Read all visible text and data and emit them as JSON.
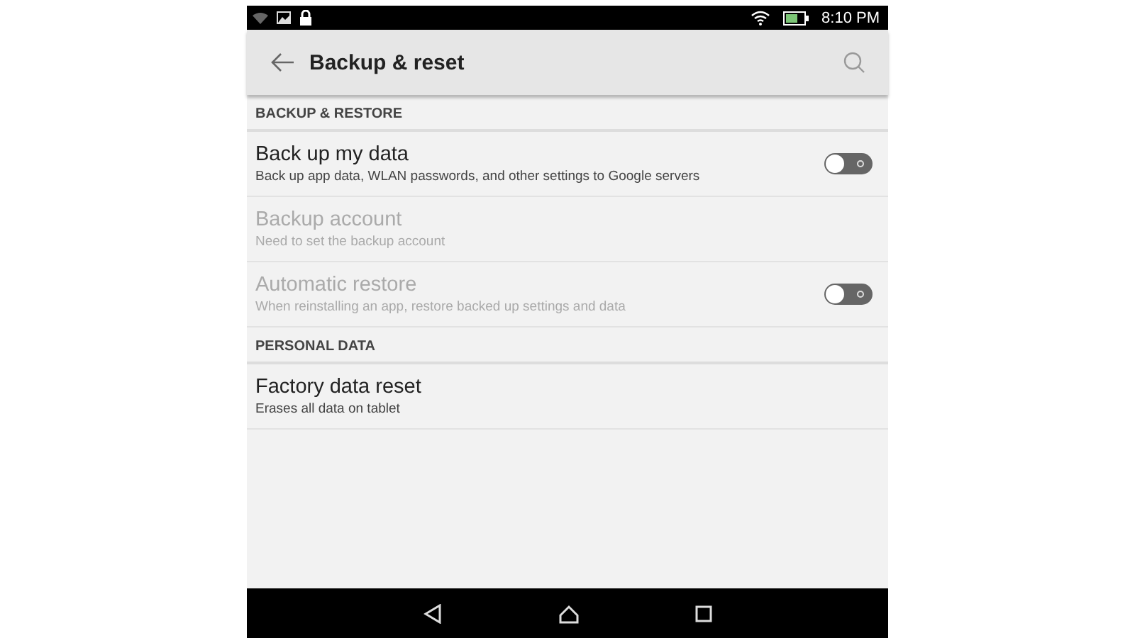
{
  "status_bar": {
    "time": "8:10 PM"
  },
  "app_bar": {
    "title": "Backup & reset"
  },
  "sections": [
    {
      "header": "BACKUP & RESTORE",
      "items": [
        {
          "kind": "toggle",
          "title": "Back up my data",
          "summary": "Back up app data, WLAN passwords, and other settings to Google servers",
          "disabled": false,
          "on": false
        },
        {
          "kind": "plain",
          "title": "Backup account",
          "summary": "Need to set the backup account",
          "disabled": true
        },
        {
          "kind": "toggle",
          "title": "Automatic restore",
          "summary": "When reinstalling an app, restore backed up settings and data",
          "disabled": true,
          "on": false
        }
      ]
    },
    {
      "header": "PERSONAL DATA",
      "items": [
        {
          "kind": "plain",
          "title": "Factory data reset",
          "summary": "Erases all data on tablet",
          "disabled": false
        }
      ]
    }
  ]
}
